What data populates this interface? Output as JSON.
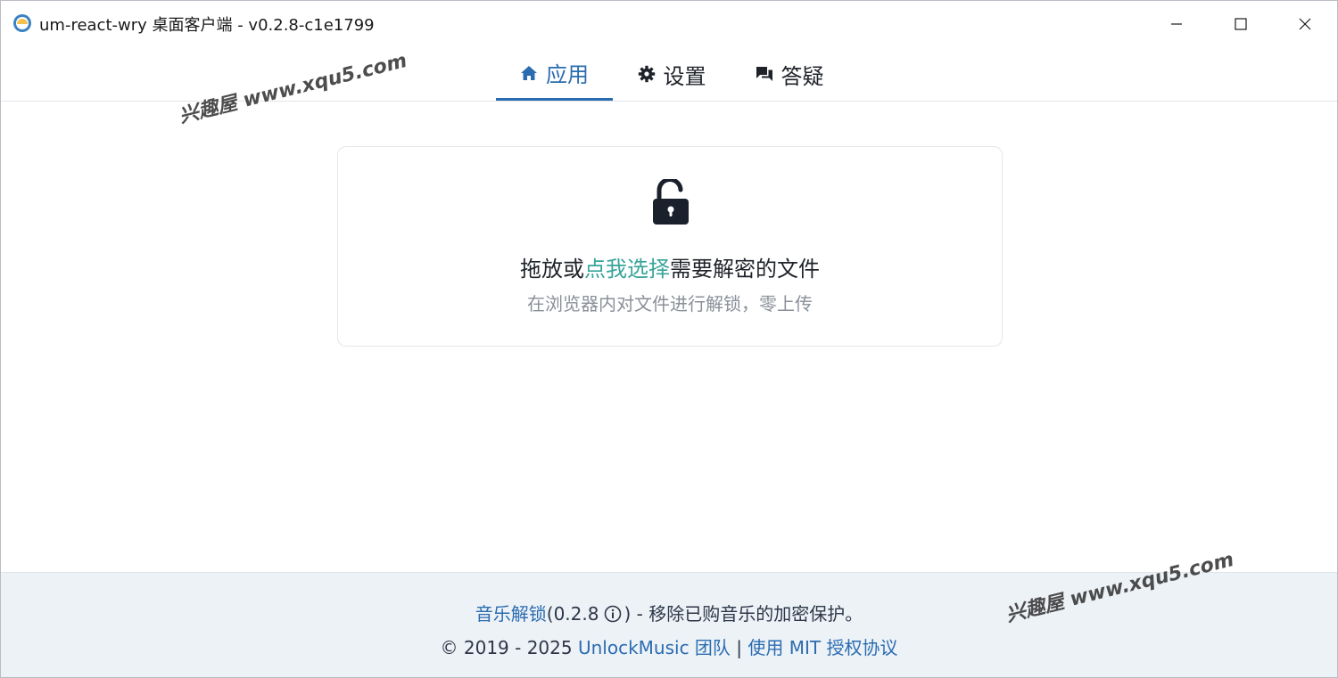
{
  "window": {
    "title": "um-react-wry 桌面客户端 - v0.2.8-c1e1799"
  },
  "tabs": [
    {
      "label": "应用",
      "icon": "home-icon",
      "active": true
    },
    {
      "label": "设置",
      "icon": "gear-icon",
      "active": false
    },
    {
      "label": "答疑",
      "icon": "chat-icon",
      "active": false
    }
  ],
  "dropzone": {
    "icon": "lock-open-icon",
    "title_before": "拖放或",
    "title_link": "点我选择",
    "title_after": "需要解密的文件",
    "subtitle": "在浏览器内对文件进行解锁，零上传"
  },
  "footer": {
    "app_link": "音乐解锁",
    "version_open": "(0.2.8",
    "version_close": ")",
    "tagline": " - 移除已购音乐的加密保护。",
    "copyright": "© 2019 - 2025 ",
    "team_link": "UnlockMusic 团队",
    "separator": " | ",
    "license_link": "使用 MIT 授权协议"
  },
  "watermark": {
    "text": "兴趣屋 www.xqu5.com"
  },
  "colors": {
    "accent": "#2b6cb0",
    "link_green": "#38a59a",
    "footer_bg": "#edf2f7"
  }
}
